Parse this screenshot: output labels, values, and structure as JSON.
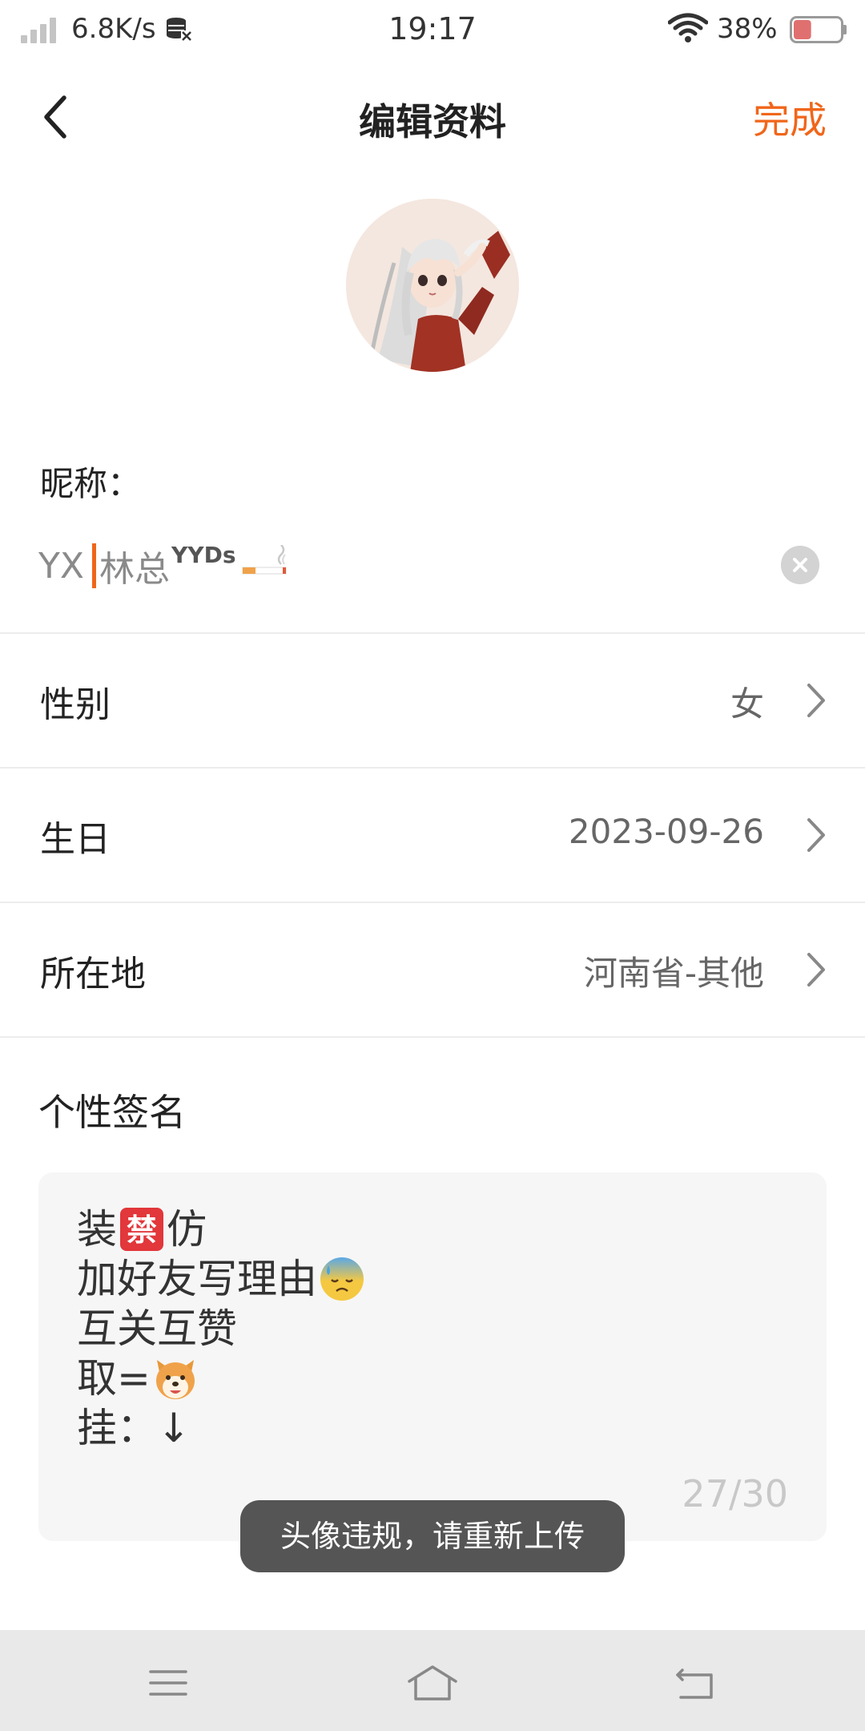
{
  "status_bar": {
    "net_speed": "6.8K/s",
    "time": "19:17",
    "battery_percent": "38%",
    "battery_level": 0.38,
    "icons": [
      "signal-icon",
      "data-saver-icon",
      "wifi-icon",
      "battery-icon"
    ]
  },
  "header": {
    "title": "编辑资料",
    "done_label": "完成",
    "back_icon": "chevron-left-icon",
    "accent_color": "#f0661a"
  },
  "avatar": {
    "icon": "avatar-anime-girl"
  },
  "nickname": {
    "label": "昵称：",
    "prefix": "YX",
    "main": "林总",
    "superscript": "YYDs",
    "emoji": "cigarette-emoji",
    "clear_icon": "clear-icon"
  },
  "profile_rows": [
    {
      "label": "性别",
      "value": "女"
    },
    {
      "label": "生日",
      "value": "2023-09-26"
    },
    {
      "label": "所在地",
      "value": "河南省-其他"
    }
  ],
  "signature": {
    "title": "个性签名",
    "lines": [
      {
        "before": "装",
        "emoji": "prohibited-emoji",
        "emoji_text": "禁",
        "after": "仿"
      },
      {
        "before": "加好友写理由",
        "emoji": "anxious-sweat-face-emoji",
        "after": ""
      },
      {
        "before": "互关互赞",
        "emoji": "",
        "after": ""
      },
      {
        "before": "取=",
        "emoji": "dog-face-emoji",
        "after": ""
      },
      {
        "before": "挂：↓",
        "emoji": "",
        "after": ""
      }
    ],
    "counter": "27/30"
  },
  "toast": {
    "message": "头像违规，请重新上传"
  },
  "nav_bar": {
    "icons": [
      "menu-icon",
      "home-icon",
      "back-icon"
    ]
  }
}
